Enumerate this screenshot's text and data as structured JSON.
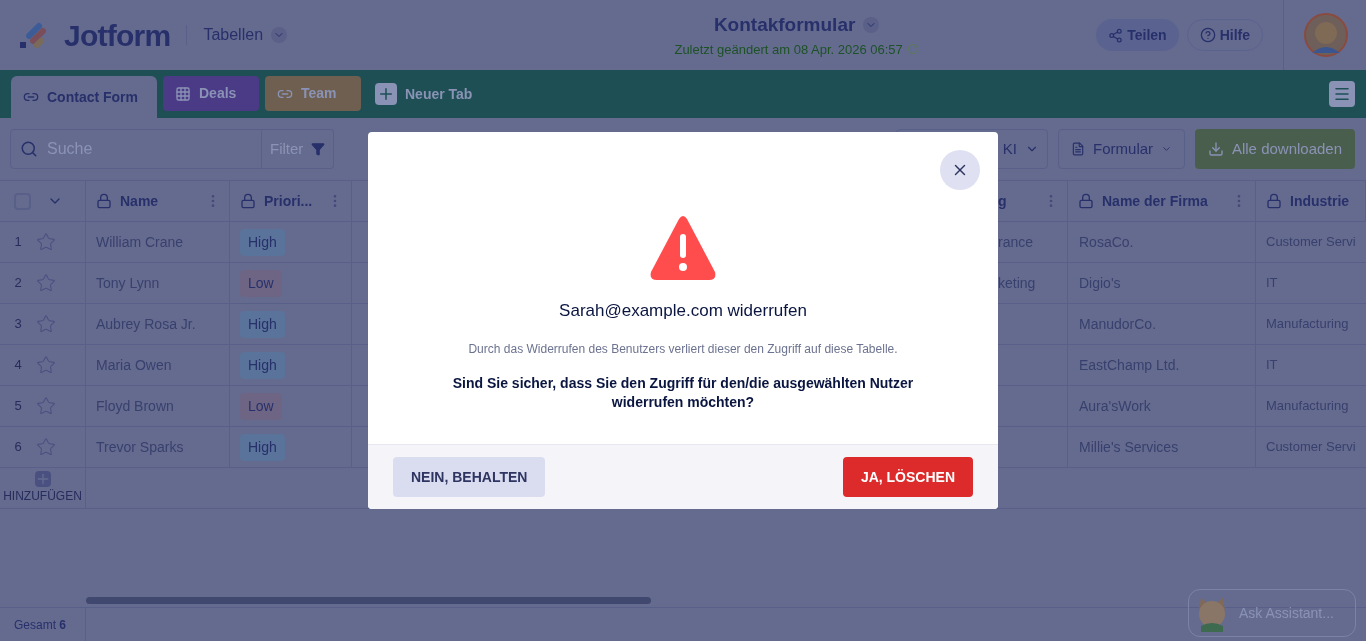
{
  "header": {
    "logo": "Jotform",
    "section": "Tabellen",
    "title": "Kontakformular",
    "subtitle": "Zuletzt geändert am 08 Apr. 2026 06:57",
    "buttons": [
      {
        "label": "Teilen",
        "kind": "share"
      },
      {
        "label": "Hilfe",
        "kind": "help"
      }
    ]
  },
  "tabs": [
    {
      "label": "Contact Form",
      "kind": "link",
      "selected": true
    },
    {
      "label": "Deals",
      "kind": "grid",
      "selected": false,
      "color": "#4b3a86"
    },
    {
      "label": "Team",
      "kind": "link",
      "selected": false,
      "color": "#6f5f50"
    },
    {
      "label": "Neuer Tab",
      "kind": "add"
    }
  ],
  "toolbar": {
    "search": {
      "placeholder": "Suche"
    },
    "filter": "Filter",
    "buttons": [
      {
        "label": "KI",
        "kind": "dropdown"
      },
      {
        "label": "Formular",
        "kind": "form"
      },
      {
        "label": "Alle downloaden",
        "kind": "download"
      }
    ]
  },
  "table": {
    "select_all": {
      "checked": false
    },
    "columns": [
      {
        "label": "Name"
      },
      {
        "label": "Priori..."
      },
      {
        "label": "g"
      },
      {
        "label": "Name der Firma"
      },
      {
        "label": "Industrie"
      }
    ],
    "rows": [
      {
        "number": "1",
        "starred": false,
        "name": "William Crane",
        "priority": {
          "text": "High",
          "color": "#5a739a"
        },
        "column_3": "rance",
        "company": "RosaCo.",
        "industry": "Customer Servi"
      },
      {
        "number": "2",
        "starred": false,
        "name": "Tony Lynn",
        "priority": {
          "text": "Low",
          "color": "#6e6585"
        },
        "column_3": "keting",
        "company": "Digio's",
        "industry": "IT"
      },
      {
        "number": "3",
        "starred": false,
        "name": "Aubrey Rosa Jr.",
        "priority": {
          "text": "High",
          "color": "#5a739a"
        },
        "company": "ManudorCo.",
        "industry": "Manufacturing"
      },
      {
        "number": "4",
        "starred": false,
        "name": "Maria Owen",
        "priority": {
          "text": "High",
          "color": "#5a739a"
        },
        "company": "EastChamp Ltd.",
        "industry": "IT"
      },
      {
        "number": "5",
        "starred": false,
        "name": "Floyd Brown",
        "priority": {
          "text": "Low",
          "color": "#6e6585"
        },
        "company": "Aura'sWork",
        "industry": "Manufacturing"
      },
      {
        "number": "6",
        "starred": false,
        "name": "Trevor Sparks",
        "priority": {
          "text": "High",
          "color": "#5a739a"
        },
        "company": "Millie's Services",
        "industry": "Customer Servi"
      }
    ],
    "add": "HINZUFÜGEN"
  },
  "footer": {
    "total": "Gesamt **6**"
  },
  "assistant": {
    "label": "Ask Assistant..."
  },
  "dialog": {
    "title": "Sarah@example.com widerrufen",
    "description": "Durch das Widerrufen des Benutzers verliert dieser den Zugriff auf diese Tabelle.",
    "question": "Sind Sie sicher, dass Sie den Zugriff für den/die ausgewählten Nutzer widerrufen möchten?",
    "cancel": "NEIN, BEHALTEN",
    "confirm": "JA, LÖSCHEN"
  }
}
